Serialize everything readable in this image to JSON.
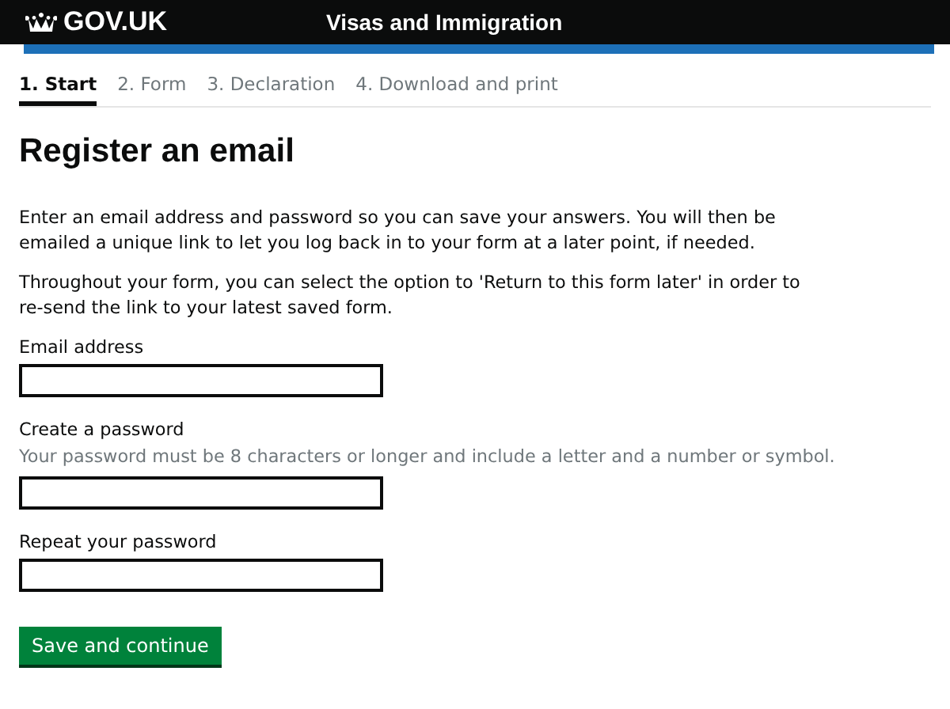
{
  "header": {
    "logo": "GOV.UK",
    "service": "Visas and Immigration"
  },
  "steps": [
    {
      "label": "1. Start",
      "selected": true
    },
    {
      "label": "2. Form",
      "selected": false
    },
    {
      "label": "3. Declaration",
      "selected": false
    },
    {
      "label": "4. Download and print",
      "selected": false
    }
  ],
  "title": "Register an email",
  "paragraphs": [
    "Enter an email address and password so you can save your answers. You will then be emailed a unique link to let you log back in to your form at a later point, if needed.",
    "Throughout your form, you can select the option to 'Return to this form later' in order to re-send the link to your latest saved form."
  ],
  "fields": [
    {
      "label": "Email address"
    },
    {
      "label": "Create a password",
      "hint": "Your password must be 8 characters or longer and include a letter and a number or symbol."
    },
    {
      "label": "Repeat your password"
    }
  ],
  "button": "Save and continue"
}
